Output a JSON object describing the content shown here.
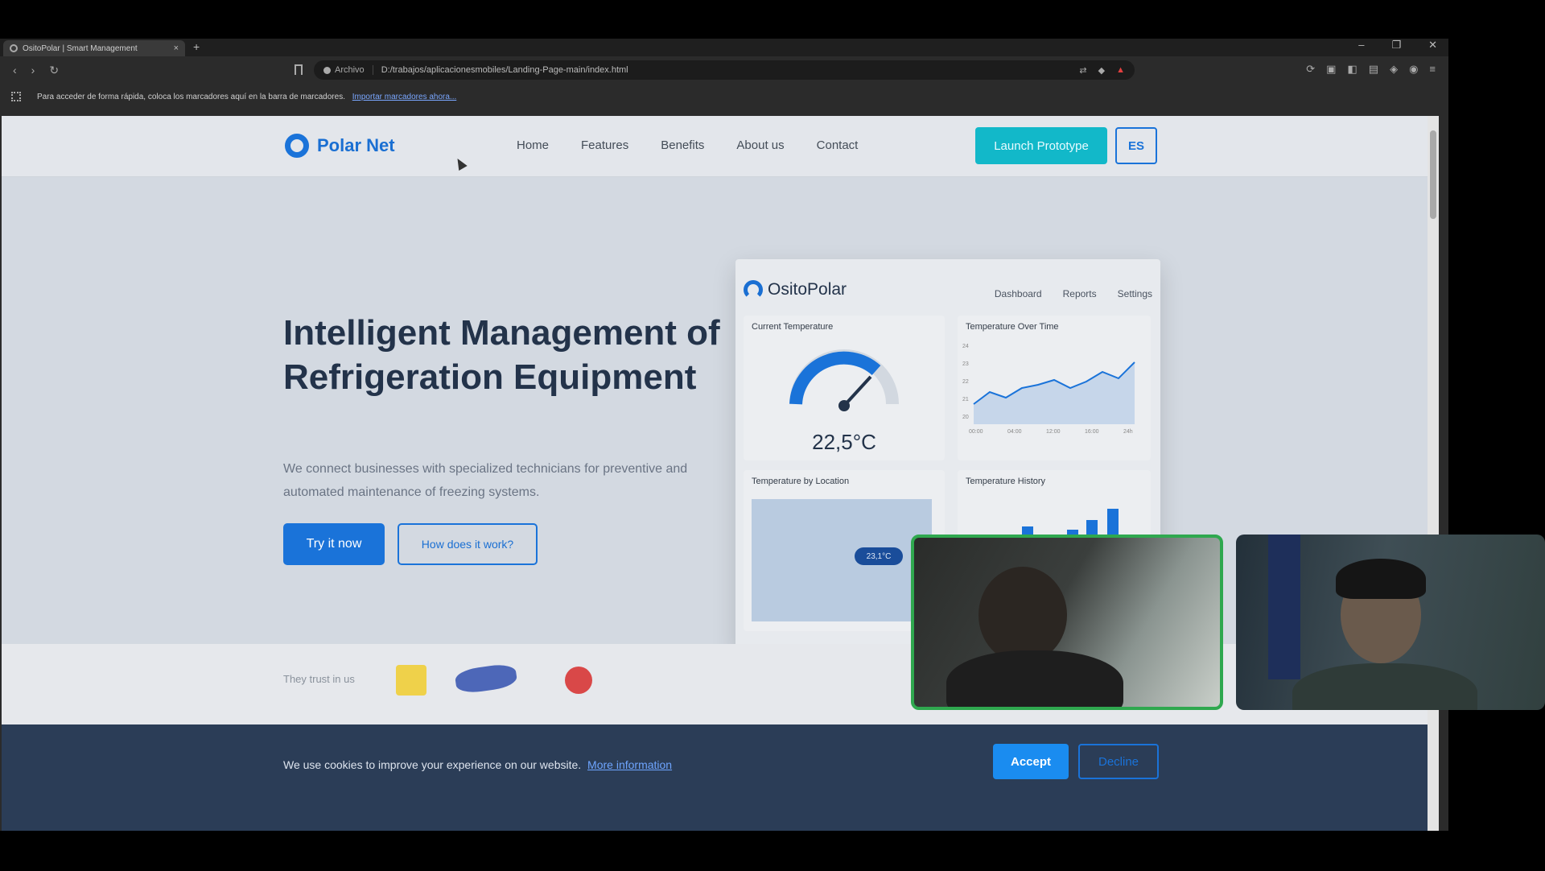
{
  "browser": {
    "tab_title": "OsitoPolar | Smart Management",
    "tab_close": "×",
    "new_tab": "+",
    "address_chip": "Archivo",
    "url": "D:/trabajos/aplicacionesmobiles/Landing-Page-main/index.html",
    "bookmarks_hint": "Para acceder de forma rápida, coloca los marcadores aquí en la barra de marcadores.",
    "bookmarks_link": "Importar marcadores ahora..."
  },
  "site": {
    "brand": "Polar Net",
    "nav": [
      "Home",
      "Features",
      "Benefits",
      "About us",
      "Contact"
    ],
    "launch_button": "Launch Prototype",
    "lang_button": "ES"
  },
  "hero": {
    "title": "Intelligent Management of Refrigeration Equipment",
    "subtitle": "We connect businesses with specialized technicians for preventive and automated maintenance of freezing systems.",
    "primary_cta": "Try it now",
    "secondary_cta": "How does it work?"
  },
  "dashboard": {
    "brand": "OsitoPolar",
    "nav": [
      "Dashboard",
      "Reports",
      "Settings"
    ],
    "cards": {
      "current_temp_title": "Current Temperature",
      "current_temp_value": "22,5°C",
      "over_time_title": "Temperature Over Time",
      "by_location_title": "Temperature by Location",
      "location_pin": "23,1°C",
      "history_title": "Temperature History"
    },
    "over_time_x": [
      "00:00",
      "04:00",
      "12:00",
      "16:00",
      "24h"
    ],
    "over_time_y": [
      "24",
      "23",
      "22",
      "21",
      "20"
    ]
  },
  "trust": {
    "label": "They trust in us"
  },
  "cookie": {
    "text": "We use cookies to improve your experience on our website.",
    "link": "More information",
    "accept": "Accept",
    "decline": "Decline"
  },
  "colors": {
    "accent": "#1a73d9",
    "teal": "#12b8c9",
    "cookie_bg": "#2b3d57",
    "active_speaker": "#2fa84f"
  },
  "icons": [
    "back-icon",
    "forward-icon",
    "reload-icon",
    "bookmark-icon",
    "menu-icon"
  ]
}
